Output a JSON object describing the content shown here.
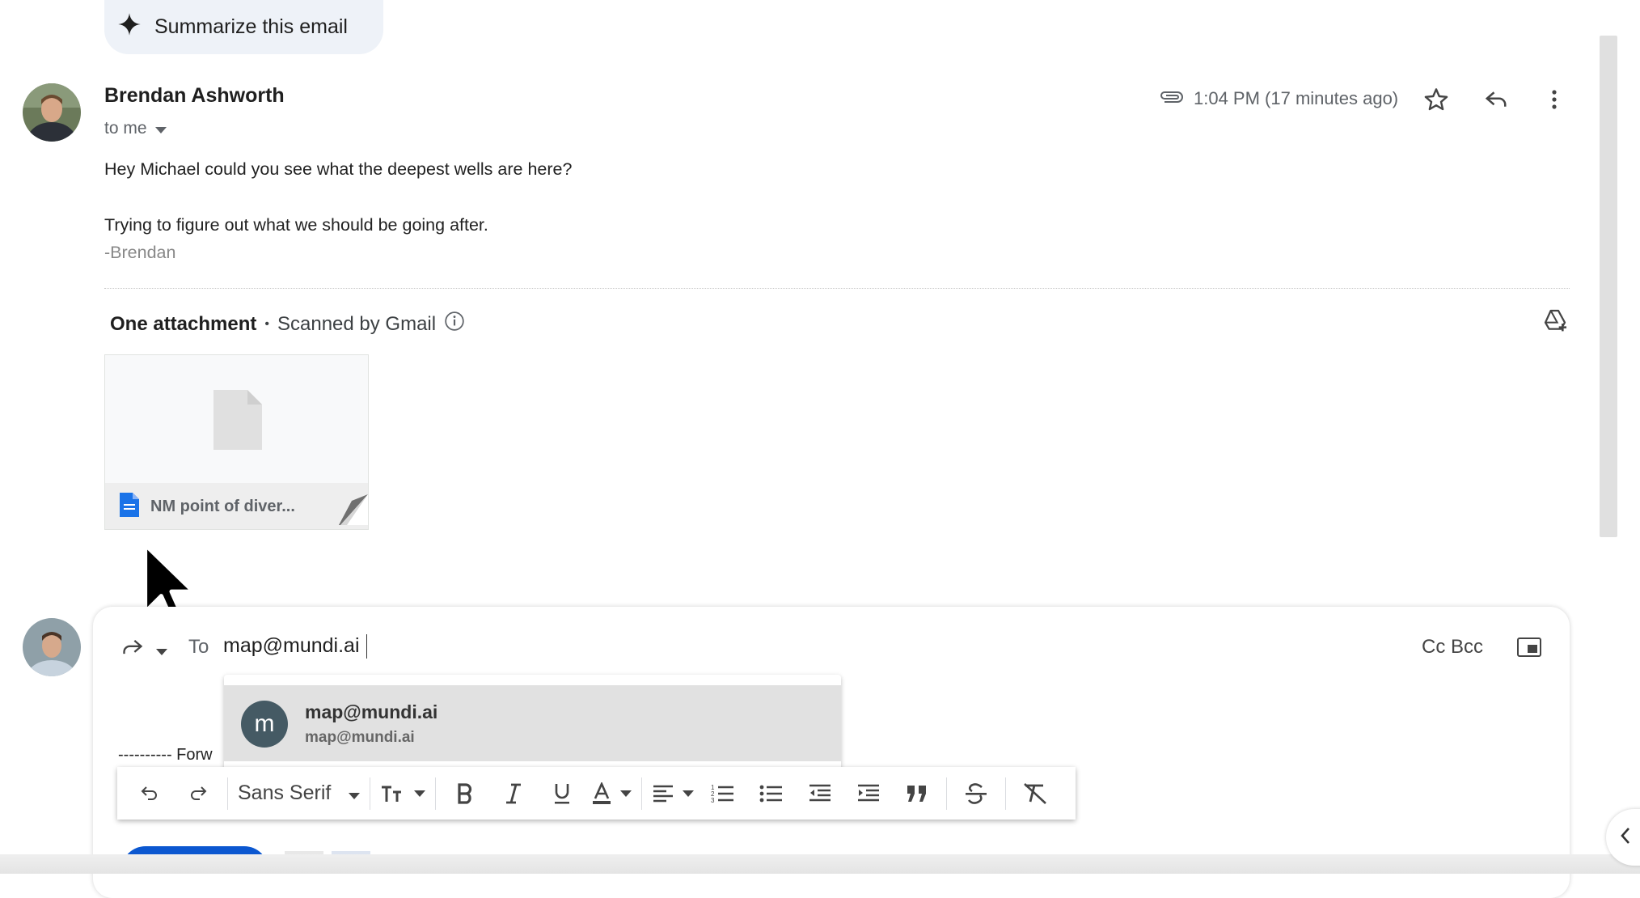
{
  "summarize": {
    "label": "Summarize this email"
  },
  "message": {
    "sender": "Brendan Ashworth",
    "recipient_line": "to me",
    "time": "1:04 PM (17 minutes ago)",
    "body_line1": "Hey Michael could you see what the deepest wells are here?",
    "body_line2": "Trying to figure out what we should be going after.",
    "signature": "-Brendan"
  },
  "attachments": {
    "title": "One attachment",
    "separator": "•",
    "scanned": "Scanned by Gmail",
    "file_name": "NM point of diver..."
  },
  "compose": {
    "to_label": "To",
    "to_value": "map@mundi.ai",
    "cc_bcc": "Cc Bcc",
    "forward_line": "---------- Forw"
  },
  "suggestion": {
    "initial": "m",
    "name": "map@mundi.ai",
    "email": "map@mundi.ai"
  },
  "toolbar": {
    "font": "Sans Serif"
  },
  "colors": {
    "accent": "#0b57d0",
    "chip_bg": "#eef2f8",
    "suggest_highlight": "#e1e1e1",
    "file_icon": "#1a73e8"
  }
}
